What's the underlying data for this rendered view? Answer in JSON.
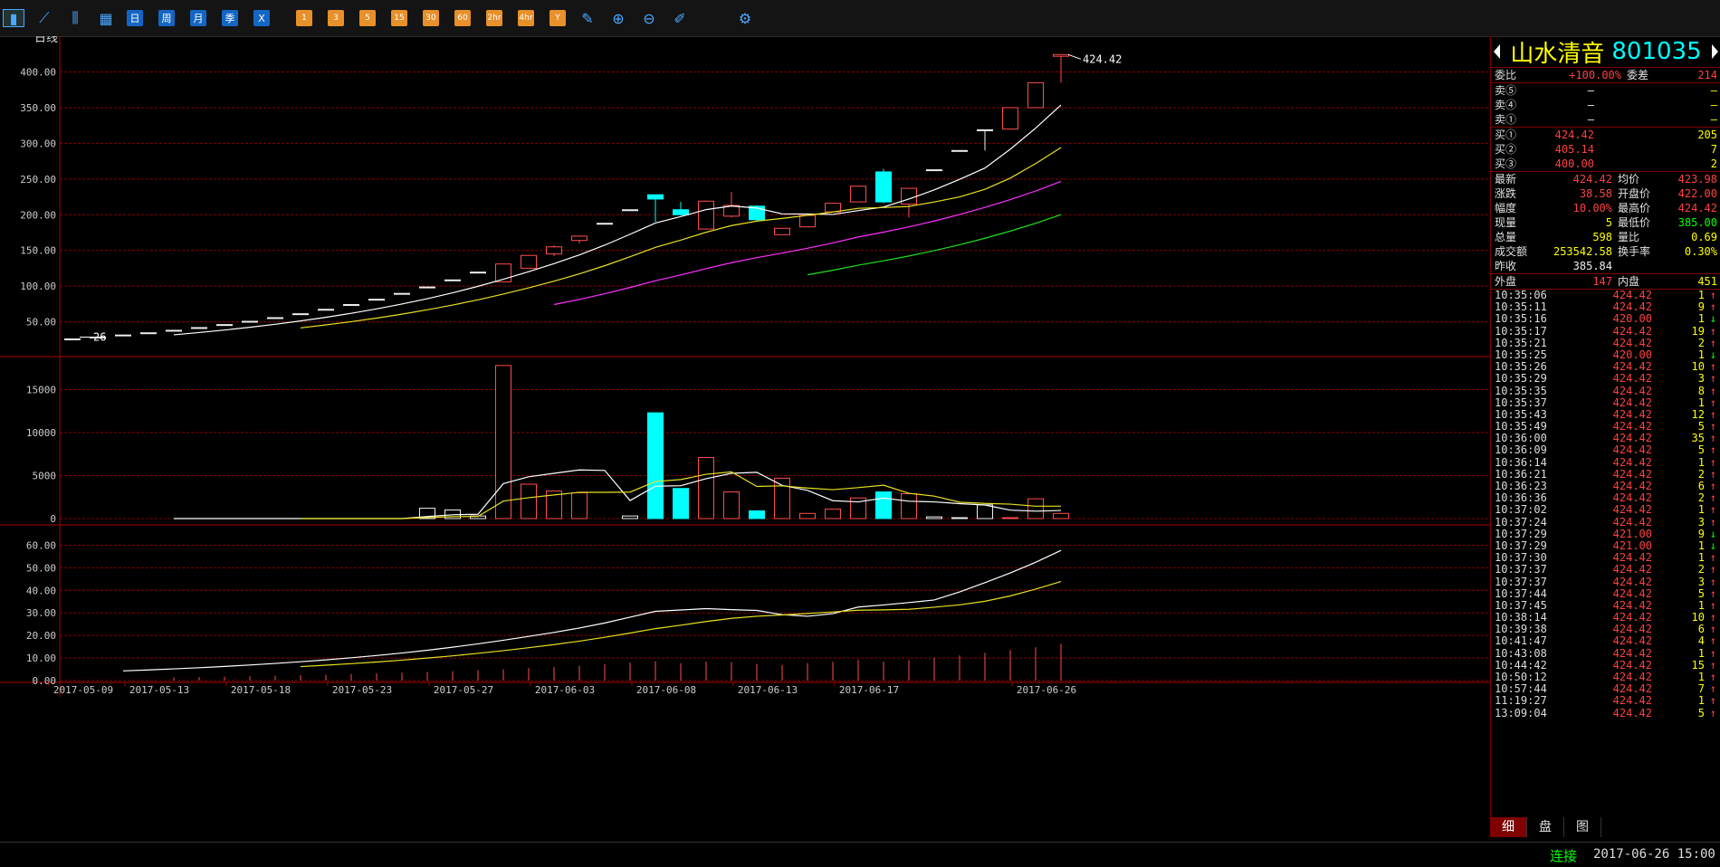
{
  "toolbar": {
    "buttons": [
      {
        "name": "bar-chart-icon",
        "icon": "▮",
        "kind": "icon"
      },
      {
        "name": "line-chart-icon",
        "icon": "⟋",
        "kind": "icon"
      },
      {
        "name": "candle-icon",
        "icon": "⫼",
        "kind": "icon"
      },
      {
        "name": "calendar-icon",
        "icon": "▦",
        "kind": "icon"
      },
      {
        "name": "period-day",
        "label": "日",
        "kind": "blue"
      },
      {
        "name": "period-week",
        "label": "周",
        "kind": "blue"
      },
      {
        "name": "period-month",
        "label": "月",
        "kind": "blue"
      },
      {
        "name": "period-quarter",
        "label": "季",
        "kind": "blue"
      },
      {
        "name": "period-year",
        "label": "X",
        "kind": "blue"
      },
      {
        "name": "period-1m",
        "label": "1",
        "kind": "orange"
      },
      {
        "name": "period-3m",
        "label": "3",
        "kind": "orange"
      },
      {
        "name": "period-5m",
        "label": "5",
        "kind": "orange"
      },
      {
        "name": "period-15m",
        "label": "15",
        "kind": "orange"
      },
      {
        "name": "period-30m",
        "label": "30",
        "kind": "orange"
      },
      {
        "name": "period-60m",
        "label": "60",
        "kind": "orange"
      },
      {
        "name": "period-2h",
        "label": "2hr",
        "kind": "orange"
      },
      {
        "name": "period-4h",
        "label": "4hr",
        "kind": "orange"
      },
      {
        "name": "period-y",
        "label": "Y",
        "kind": "orange"
      },
      {
        "name": "draw-icon",
        "icon": "✎",
        "kind": "icon"
      },
      {
        "name": "zoom-in-icon",
        "icon": "⊕",
        "kind": "icon"
      },
      {
        "name": "zoom-out-icon",
        "icon": "⊖",
        "kind": "icon"
      },
      {
        "name": "pen-icon",
        "icon": "✐",
        "kind": "icon"
      },
      {
        "name": "gear-icon",
        "icon": "⚙",
        "kind": "icon"
      }
    ]
  },
  "chart_data": {
    "type": "candlestick",
    "period_label": "日线",
    "price_axis": [
      "400.00",
      "350.00",
      "300.00",
      "250.00",
      "200.00",
      "150.00",
      "100.00",
      "50.00"
    ],
    "volume_axis": [
      "15000",
      "10000",
      "5000",
      "0"
    ],
    "indicator_axis": [
      "60.00",
      "50.00",
      "40.00",
      "30.00",
      "20.00",
      "10.00",
      "0.00"
    ],
    "x_labels": [
      "2017-05-09",
      "2017-05-13",
      "2017-05-18",
      "2017-05-23",
      "2017-05-27",
      "2017-06-03",
      "2017-06-08",
      "2017-06-13",
      "2017-06-17",
      "2017-06-26"
    ],
    "min_label": "26",
    "max_label": "424.42",
    "candles": [
      {
        "o": 26,
        "h": 26,
        "l": 26,
        "c": 26,
        "v": 0
      },
      {
        "o": 28.6,
        "h": 28.6,
        "l": 28.6,
        "c": 28.6,
        "v": 0
      },
      {
        "o": 31.5,
        "h": 31.5,
        "l": 31.5,
        "c": 31.5,
        "v": 0
      },
      {
        "o": 34.6,
        "h": 34.6,
        "l": 34.6,
        "c": 34.6,
        "v": 0
      },
      {
        "o": 38.1,
        "h": 38.1,
        "l": 38.1,
        "c": 38.1,
        "v": 0
      },
      {
        "o": 41.9,
        "h": 41.9,
        "l": 41.9,
        "c": 41.9,
        "v": 0
      },
      {
        "o": 46.1,
        "h": 46.1,
        "l": 46.1,
        "c": 46.1,
        "v": 0
      },
      {
        "o": 50.7,
        "h": 50.7,
        "l": 50.7,
        "c": 50.7,
        "v": 0
      },
      {
        "o": 55.8,
        "h": 55.8,
        "l": 55.8,
        "c": 55.8,
        "v": 0
      },
      {
        "o": 61.3,
        "h": 61.3,
        "l": 61.3,
        "c": 61.3,
        "v": 0
      },
      {
        "o": 67.5,
        "h": 67.5,
        "l": 67.5,
        "c": 67.5,
        "v": 0
      },
      {
        "o": 74.2,
        "h": 74.2,
        "l": 74.2,
        "c": 74.2,
        "v": 0
      },
      {
        "o": 81.6,
        "h": 81.6,
        "l": 81.6,
        "c": 81.6,
        "v": 0
      },
      {
        "o": 89.8,
        "h": 89.8,
        "l": 89.8,
        "c": 89.8,
        "v": 0
      },
      {
        "o": 98.8,
        "h": 98.8,
        "l": 98.8,
        "c": 98.8,
        "v": 1200
      },
      {
        "o": 108.7,
        "h": 108.7,
        "l": 108.7,
        "c": 108.7,
        "v": 1000
      },
      {
        "o": 119.6,
        "h": 119.6,
        "l": 119.6,
        "c": 119.6,
        "v": 300
      },
      {
        "o": 106,
        "h": 131,
        "l": 106,
        "c": 131,
        "v": 17800
      },
      {
        "o": 125,
        "h": 143,
        "l": 125,
        "c": 143,
        "v": 4000
      },
      {
        "o": 145,
        "h": 157,
        "l": 142,
        "c": 155,
        "v": 3200
      },
      {
        "o": 164,
        "h": 171,
        "l": 160,
        "c": 170,
        "v": 3000
      },
      {
        "o": 188,
        "h": 188,
        "l": 188,
        "c": 188,
        "v": 0
      },
      {
        "o": 207,
        "h": 207,
        "l": 207,
        "c": 207,
        "v": 300
      },
      {
        "o": 228,
        "h": 228,
        "l": 190,
        "c": 222,
        "v": 12300
      },
      {
        "o": 207,
        "h": 218,
        "l": 199,
        "c": 200,
        "v": 3500
      },
      {
        "o": 180,
        "h": 220,
        "l": 180,
        "c": 219,
        "v": 7100
      },
      {
        "o": 198,
        "h": 232,
        "l": 196,
        "c": 213,
        "v": 3100
      },
      {
        "o": 212,
        "h": 213,
        "l": 190,
        "c": 193,
        "v": 900
      },
      {
        "o": 172,
        "h": 181,
        "l": 172,
        "c": 181,
        "v": 4700
      },
      {
        "o": 183,
        "h": 199,
        "l": 183,
        "c": 199,
        "v": 600
      },
      {
        "o": 204,
        "h": 217,
        "l": 204,
        "c": 216,
        "v": 1100
      },
      {
        "o": 218,
        "h": 240,
        "l": 218,
        "c": 240,
        "v": 2400
      },
      {
        "o": 260,
        "h": 264,
        "l": 216,
        "c": 218,
        "v": 3100
      },
      {
        "o": 215,
        "h": 237,
        "l": 196,
        "c": 237,
        "v": 2900
      },
      {
        "o": 263,
        "h": 263,
        "l": 263,
        "c": 263,
        "v": 200
      },
      {
        "o": 290,
        "h": 290,
        "l": 290,
        "c": 290,
        "v": 100
      },
      {
        "o": 319,
        "h": 319,
        "l": 290,
        "c": 319,
        "v": 1600
      },
      {
        "o": 320,
        "h": 350,
        "l": 320,
        "c": 350,
        "v": 100
      },
      {
        "o": 350,
        "h": 385,
        "l": 350,
        "c": 385,
        "v": 2300
      },
      {
        "o": 422,
        "h": 424.42,
        "l": 385,
        "c": 424.42,
        "v": 598
      }
    ]
  },
  "quote": {
    "name": "山水清音",
    "code": "801035",
    "weibi_label": "委比",
    "weibi": "+100.00%",
    "weicha_label": "委差",
    "weicha": "214",
    "sells": [
      {
        "l": "卖⑤",
        "p": "—",
        "v": "—"
      },
      {
        "l": "卖④",
        "p": "—",
        "v": "—"
      },
      {
        "l": "卖①",
        "p": "—",
        "v": "—"
      }
    ],
    "buys": [
      {
        "l": "买①",
        "p": "424.42",
        "v": "205"
      },
      {
        "l": "买②",
        "p": "405.14",
        "v": "7"
      },
      {
        "l": "买③",
        "p": "400.00",
        "v": "2"
      }
    ],
    "stats": [
      {
        "a": "最新",
        "b": "424.42",
        "bc": "red",
        "c": "均价",
        "d": "423.98",
        "dc": "red"
      },
      {
        "a": "涨跌",
        "b": "38.58",
        "bc": "red",
        "c": "开盘价",
        "d": "422.00",
        "dc": "red"
      },
      {
        "a": "幅度",
        "b": "10.00%",
        "bc": "red",
        "c": "最高价",
        "d": "424.42",
        "dc": "red"
      },
      {
        "a": "现量",
        "b": "5",
        "bc": "yel",
        "c": "最低价",
        "d": "385.00",
        "dc": "grn"
      },
      {
        "a": "总量",
        "b": "598",
        "bc": "yel",
        "c": "量比",
        "d": "0.69",
        "dc": "yel"
      },
      {
        "a": "成交额",
        "b": "253542.58",
        "bc": "yel",
        "c": "换手率",
        "d": "0.30%",
        "dc": "yel"
      },
      {
        "a": "昨收",
        "b": "385.84",
        "bc": "white",
        "c": "",
        "d": "",
        "dc": "white"
      }
    ],
    "outer_label": "外盘",
    "outer": "147",
    "inner_label": "内盘",
    "inner": "451"
  },
  "ticks": [
    {
      "t": "10:35:06",
      "p": "424.42",
      "v": "1",
      "d": "up"
    },
    {
      "t": "10:35:11",
      "p": "424.42",
      "v": "9",
      "d": "up"
    },
    {
      "t": "10:35:16",
      "p": "420.00",
      "v": "1",
      "d": "down"
    },
    {
      "t": "10:35:17",
      "p": "424.42",
      "v": "19",
      "d": "up"
    },
    {
      "t": "10:35:21",
      "p": "424.42",
      "v": "2",
      "d": "up"
    },
    {
      "t": "10:35:25",
      "p": "420.00",
      "v": "1",
      "d": "down"
    },
    {
      "t": "10:35:26",
      "p": "424.42",
      "v": "10",
      "d": "up"
    },
    {
      "t": "10:35:29",
      "p": "424.42",
      "v": "3",
      "d": "up"
    },
    {
      "t": "10:35:35",
      "p": "424.42",
      "v": "8",
      "d": "up"
    },
    {
      "t": "10:35:37",
      "p": "424.42",
      "v": "1",
      "d": "up"
    },
    {
      "t": "10:35:43",
      "p": "424.42",
      "v": "12",
      "d": "up"
    },
    {
      "t": "10:35:49",
      "p": "424.42",
      "v": "5",
      "d": "up"
    },
    {
      "t": "10:36:00",
      "p": "424.42",
      "v": "35",
      "d": "up"
    },
    {
      "t": "10:36:09",
      "p": "424.42",
      "v": "5",
      "d": "up"
    },
    {
      "t": "10:36:14",
      "p": "424.42",
      "v": "1",
      "d": "up"
    },
    {
      "t": "10:36:21",
      "p": "424.42",
      "v": "2",
      "d": "up"
    },
    {
      "t": "10:36:23",
      "p": "424.42",
      "v": "6",
      "d": "up"
    },
    {
      "t": "10:36:36",
      "p": "424.42",
      "v": "2",
      "d": "up"
    },
    {
      "t": "10:37:02",
      "p": "424.42",
      "v": "1",
      "d": "up"
    },
    {
      "t": "10:37:24",
      "p": "424.42",
      "v": "3",
      "d": "up"
    },
    {
      "t": "10:37:29",
      "p": "421.00",
      "v": "9",
      "d": "down"
    },
    {
      "t": "10:37:29",
      "p": "421.00",
      "v": "1",
      "d": "down"
    },
    {
      "t": "10:37:30",
      "p": "424.42",
      "v": "1",
      "d": "up"
    },
    {
      "t": "10:37:37",
      "p": "424.42",
      "v": "2",
      "d": "up"
    },
    {
      "t": "10:37:37",
      "p": "424.42",
      "v": "3",
      "d": "up"
    },
    {
      "t": "10:37:44",
      "p": "424.42",
      "v": "5",
      "d": "up"
    },
    {
      "t": "10:37:45",
      "p": "424.42",
      "v": "1",
      "d": "up"
    },
    {
      "t": "10:38:14",
      "p": "424.42",
      "v": "10",
      "d": "up"
    },
    {
      "t": "10:39:38",
      "p": "424.42",
      "v": "6",
      "d": "up"
    },
    {
      "t": "10:41:47",
      "p": "424.42",
      "v": "4",
      "d": "up"
    },
    {
      "t": "10:43:08",
      "p": "424.42",
      "v": "1",
      "d": "up"
    },
    {
      "t": "10:44:42",
      "p": "424.42",
      "v": "15",
      "d": "up"
    },
    {
      "t": "10:50:12",
      "p": "424.42",
      "v": "1",
      "d": "up"
    },
    {
      "t": "10:57:44",
      "p": "424.42",
      "v": "7",
      "d": "up"
    },
    {
      "t": "11:19:27",
      "p": "424.42",
      "v": "1",
      "d": "up"
    },
    {
      "t": "13:09:04",
      "p": "424.42",
      "v": "5",
      "d": "up"
    }
  ],
  "tabs": [
    "细",
    "盘",
    "图"
  ],
  "status": {
    "conn": "连接",
    "time": "2017-06-26 15:00"
  }
}
